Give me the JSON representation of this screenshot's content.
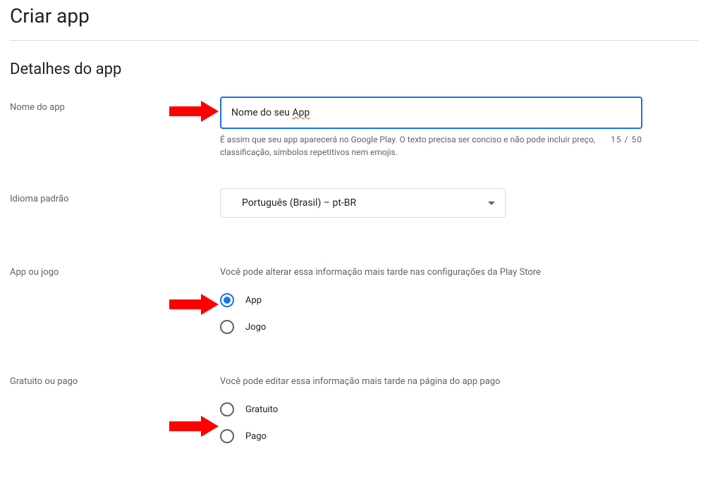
{
  "page": {
    "title": "Criar app"
  },
  "section": {
    "title": "Detalhes do app"
  },
  "fields": {
    "name": {
      "label": "Nome do app",
      "value_prefix": "Nome do seu ",
      "value_spellcheck": "App",
      "helper": "É assim que seu app aparecerá no Google Play. O texto precisa ser conciso e não pode incluir preço, classificação, símbolos repetitivos nem emojis.",
      "counter": "15 / 50"
    },
    "language": {
      "label": "Idioma padrão",
      "selected": "Português (Brasil) – pt-BR"
    },
    "app_or_game": {
      "label": "App ou jogo",
      "info": "Você pode alterar essa informação mais tarde nas configurações da Play Store",
      "options": {
        "app": {
          "label": "App",
          "checked": true
        },
        "game": {
          "label": "Jogo",
          "checked": false
        }
      }
    },
    "pricing": {
      "label": "Gratuito ou pago",
      "info": "Você pode editar essa informação mais tarde na página do app pago",
      "options": {
        "free": {
          "label": "Gratuito",
          "checked": false
        },
        "paid": {
          "label": "Pago",
          "checked": false
        }
      }
    }
  }
}
